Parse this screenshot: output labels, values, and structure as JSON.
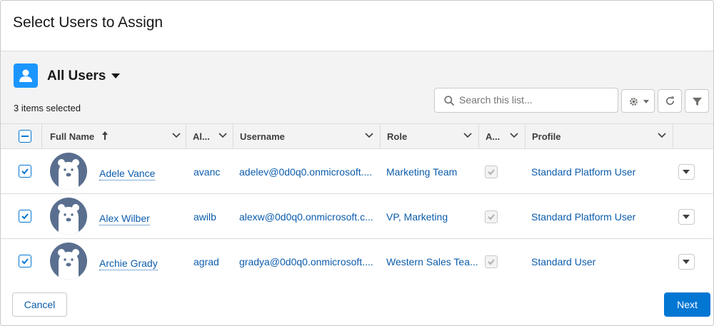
{
  "modal": {
    "title": "Select Users to Assign"
  },
  "list": {
    "title": "All Users",
    "selected_count": "3 items selected",
    "search_placeholder": "Search this list...",
    "icon": "user-icon",
    "accent": "#1b96ff"
  },
  "columns": [
    {
      "label": "Full Name",
      "sorted": "ascending"
    },
    {
      "label": "Al..."
    },
    {
      "label": "Username"
    },
    {
      "label": "Role"
    },
    {
      "label": "A..."
    },
    {
      "label": "Profile"
    }
  ],
  "rows": [
    {
      "selected": true,
      "full_name": "Adele Vance",
      "alias": "avanc",
      "username": "adelev@0d0q0.onmicrosoft....",
      "role": "Marketing Team",
      "active": true,
      "profile": "Standard Platform User"
    },
    {
      "selected": true,
      "full_name": "Alex Wilber",
      "alias": "awilb",
      "username": "alexw@0d0q0.onmicrosoft.c...",
      "role": "VP, Marketing",
      "active": true,
      "profile": "Standard Platform User"
    },
    {
      "selected": true,
      "full_name": "Archie Grady",
      "alias": "agrad",
      "username": "gradya@0d0q0.onmicrosoft....",
      "role": "Western Sales Tea...",
      "active": true,
      "profile": "Standard User"
    }
  ],
  "footer": {
    "cancel_label": "Cancel",
    "next_label": "Next"
  },
  "colors": {
    "brand": "#0176d3",
    "link": "#0b5cab",
    "avatar": "#5a6f8f"
  }
}
